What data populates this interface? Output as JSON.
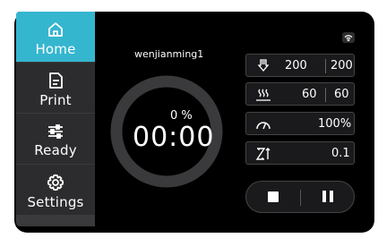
{
  "sidebar": {
    "items": [
      {
        "label": "Home",
        "icon": "home-icon",
        "active": true
      },
      {
        "label": "Print",
        "icon": "print-file-icon",
        "active": false
      },
      {
        "label": "Ready",
        "icon": "sliders-icon",
        "active": false
      },
      {
        "label": "Settings",
        "icon": "gear-icon",
        "active": false
      }
    ]
  },
  "job": {
    "filename": "wenjianming1",
    "progress_text": "0 %",
    "progress": 0,
    "time_text": "00:00"
  },
  "stats": {
    "nozzle": {
      "icon": "nozzle-temperature-icon",
      "current": "200",
      "target": "200"
    },
    "bed": {
      "icon": "bed-temperature-icon",
      "current": "60",
      "target": "60"
    },
    "speed": {
      "icon": "speed-gauge-icon",
      "value": "100%"
    },
    "z_offset": {
      "icon": "z-offset-icon",
      "value": "0.1"
    }
  },
  "controls": {
    "stop_icon": "stop-icon",
    "pause_icon": "pause-icon"
  },
  "status": {
    "wifi_icon": "wifi-icon"
  },
  "colors": {
    "accent": "#35b6cf",
    "panel": "#1a1a1c",
    "ring": "#3a3a3c"
  }
}
